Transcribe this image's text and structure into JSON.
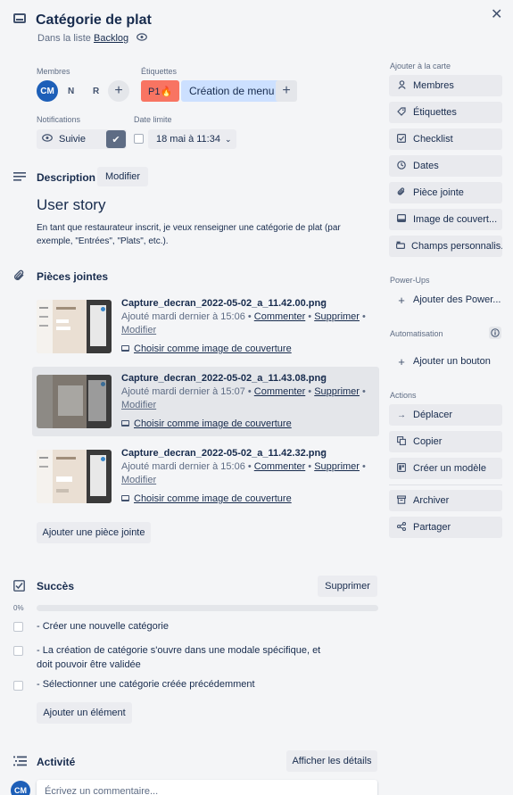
{
  "header": {
    "title": "Catégorie de plat",
    "list_prefix": "Dans la liste",
    "list_name": "Backlog"
  },
  "members": {
    "label": "Membres",
    "avatars": [
      "CM",
      "N",
      "R"
    ]
  },
  "labels": {
    "label": "Étiquettes",
    "items": [
      {
        "text": "P1🔥",
        "color": "#f87462"
      },
      {
        "text": "Création de menu",
        "color": "#cce0ff"
      }
    ]
  },
  "notifications": {
    "label": "Notifications",
    "value": "Suivie"
  },
  "due": {
    "label": "Date limite",
    "value": "18 mai à 11:34"
  },
  "description": {
    "heading": "Description",
    "edit_label": "Modifier",
    "title": "User story",
    "body": "En tant que restaurateur inscrit, je veux renseigner une catégorie de plat (par exemple, \"Entrées\", \"Plats\", etc.)."
  },
  "attachments": {
    "heading": "Pièces jointes",
    "comment_label": "Commenter",
    "delete_label": "Supprimer",
    "edit_label": "Modifier",
    "cover_label": "Choisir comme image de couverture",
    "add_label": "Ajouter une pièce jointe",
    "items": [
      {
        "name": "Capture_decran_2022-05-02_a_11.42.00.png",
        "added": "Ajouté mardi dernier à 15:06"
      },
      {
        "name": "Capture_decran_2022-05-02_a_11.43.08.png",
        "added": "Ajouté mardi dernier à 15:07"
      },
      {
        "name": "Capture_decran_2022-05-02_a_11.42.32.png",
        "added": "Ajouté mardi dernier à 15:06"
      }
    ]
  },
  "checklist": {
    "heading": "Succès",
    "delete_label": "Supprimer",
    "progress": "0%",
    "progress_value": 0,
    "items": [
      {
        "line1": "- Créer une nouvelle catégorie",
        "line2": ""
      },
      {
        "line1": "- La création de catégorie s'ouvre dans une modale spécifique, et",
        "line2": "doit pouvoir être validée"
      },
      {
        "line1": "- Sélectionner une catégorie créée précédemment",
        "line2": ""
      }
    ],
    "add_label": "Ajouter un élément"
  },
  "activity": {
    "heading": "Activité",
    "details_label": "Afficher les détails",
    "avatar": "CM",
    "comment_placeholder": "Écrivez un commentaire..."
  },
  "sidebar": {
    "add_to_card": "Ajouter à la carte",
    "add_items": [
      {
        "label": "Membres",
        "icon": "person-icon"
      },
      {
        "label": "Étiquettes",
        "icon": "tag-icon"
      },
      {
        "label": "Checklist",
        "icon": "checklist-icon"
      },
      {
        "label": "Dates",
        "icon": "clock-icon"
      },
      {
        "label": "Pièce jointe",
        "icon": "paperclip-icon"
      },
      {
        "label": "Image de couvert...",
        "icon": "cover-icon"
      },
      {
        "label": "Champs personnalis...",
        "icon": "fields-icon"
      }
    ],
    "powerups": "Power-Ups",
    "powerups_button": "Ajouter des Power...",
    "automation": "Automatisation",
    "automation_button": "Ajouter un bouton",
    "actions": "Actions",
    "action_items": [
      {
        "label": "Déplacer",
        "icon": "arrow-right-icon"
      },
      {
        "label": "Copier",
        "icon": "copy-icon"
      },
      {
        "label": "Créer un modèle",
        "icon": "template-icon"
      },
      {
        "label": "Archiver",
        "icon": "archive-icon"
      },
      {
        "label": "Partager",
        "icon": "share-icon"
      }
    ]
  }
}
